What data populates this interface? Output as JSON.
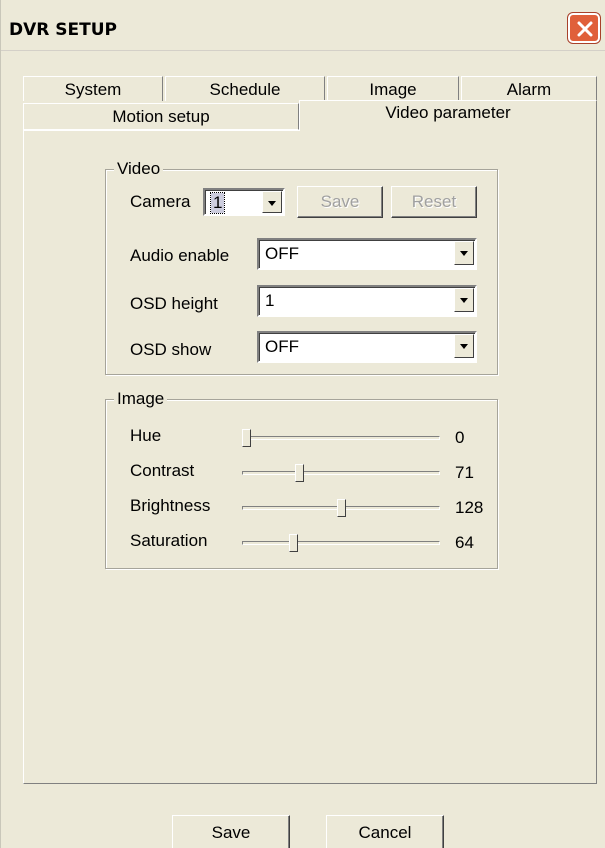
{
  "window": {
    "title": "DVR SETUP"
  },
  "tabs_row1": [
    "System",
    "Schedule",
    "Image",
    "Alarm"
  ],
  "tabs_row2": [
    "Motion setup",
    "Video parameter"
  ],
  "video_group": {
    "legend": "Video",
    "camera_label": "Camera",
    "camera_value": "1",
    "save_label": "Save",
    "reset_label": "Reset",
    "audio_enable_label": "Audio enable",
    "audio_enable_value": "OFF",
    "osd_height_label": "OSD height",
    "osd_height_value": "1",
    "osd_show_label": "OSD show",
    "osd_show_value": "OFF"
  },
  "image_group": {
    "legend": "Image",
    "sliders": [
      {
        "label": "Hue",
        "value": "0",
        "fraction": 0.0
      },
      {
        "label": "Contrast",
        "value": "71",
        "fraction": 0.28
      },
      {
        "label": "Brightness",
        "value": "128",
        "fraction": 0.5
      },
      {
        "label": "Saturation",
        "value": "64",
        "fraction": 0.25
      }
    ]
  },
  "footer": {
    "save_label": "Save",
    "cancel_label": "Cancel"
  }
}
